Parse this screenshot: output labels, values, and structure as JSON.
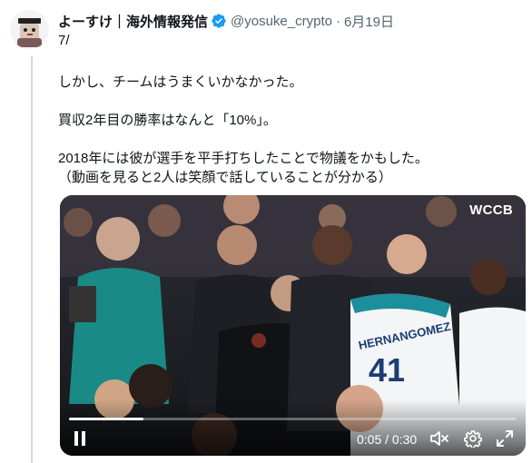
{
  "tweet": {
    "display_name": "よーすけ｜海外情報発信",
    "handle": "@yosuke_crypto",
    "separator": "·",
    "date": "6月19日",
    "index": "7/",
    "lines": [
      "しかし、チームはうまくいかなかった。",
      "",
      "買収2年目の勝率はなんと「10%」。",
      "",
      "2018年には彼が選手を平手打ちしたことで物議をかもした。",
      "（動画を見ると2人は笑顔で話していることが分かる）"
    ]
  },
  "video": {
    "watermark": "WCCB",
    "time_display": "0:05 / 0:30",
    "progress": 0.1667,
    "jersey_name": "HERNANGOMEZ",
    "jersey_number": "41"
  },
  "icons": {
    "verified": "verified-badge-icon",
    "pause": "pause-icon",
    "mute": "volume-muted-icon",
    "settings": "gear-icon",
    "fullscreen": "fullscreen-icon"
  },
  "colors": {
    "verified": "#1d9bf0",
    "muted_text": "#536471",
    "thread_line": "#cfd9de"
  }
}
